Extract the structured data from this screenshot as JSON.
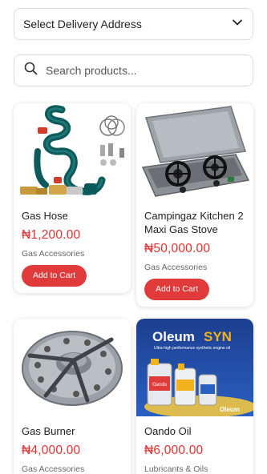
{
  "address": {
    "label": "Select Delivery Address",
    "icon": "chevron-down-icon"
  },
  "search": {
    "placeholder": "Search products...",
    "value": "",
    "icon": "search-icon"
  },
  "products": [
    {
      "name": "Gas Hose",
      "price": "₦1,200.00",
      "category": "Gas Accessories",
      "button": "Add to Cart"
    },
    {
      "name": "Campingaz Kitchen 2 Maxi Gas Stove",
      "price": "₦50,000.00",
      "category": "Gas Accessories",
      "button": "Add to Cart"
    },
    {
      "name": "Gas Burner",
      "price": "₦4,000.00",
      "category": "Gas Accessories"
    },
    {
      "name": "Oando Oil",
      "price": "₦6,000.00",
      "category": "Lubricants & Oils",
      "image_text": {
        "brand": "Oleum",
        "brand_accent": "SYN",
        "tagline": "Ultra-high performance synthetic engine oil",
        "bottle_label": "Oando",
        "corner_logo": "Oleum"
      }
    }
  ],
  "colors": {
    "accent": "#e03a3a",
    "price": "#e03131",
    "border": "#dcdcdc",
    "oleum_bg": "#1c3f8f"
  }
}
